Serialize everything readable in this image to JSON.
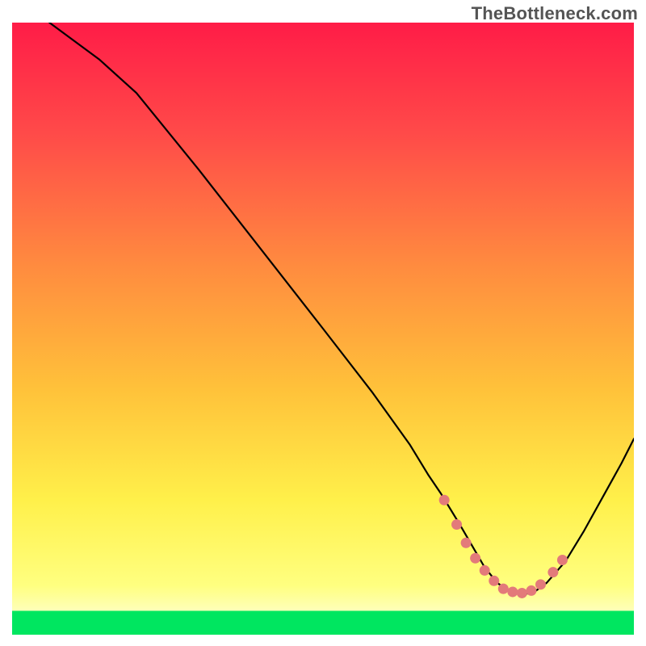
{
  "watermark": "TheBottleneck.com",
  "chart_data": {
    "type": "line",
    "title": "",
    "xlabel": "",
    "ylabel": "",
    "xlim": [
      0,
      100
    ],
    "ylim": [
      0,
      100
    ],
    "grid": false,
    "legend": false,
    "background_gradient_top": "#FF1C47",
    "background_gradient_mid": "#FFA83C",
    "background_gradient_low": "#FFFF80",
    "background_gradient_bottom_band": "#00E660",
    "series": [
      {
        "name": "bottleneck-curve",
        "color": "#000000",
        "x": [
          6,
          10,
          14,
          20,
          30,
          40,
          50,
          58,
          64,
          67,
          69,
          72,
          74,
          76,
          78,
          80,
          82,
          84,
          86,
          89,
          92,
          95,
          98,
          100
        ],
        "y": [
          100,
          97,
          94,
          88.5,
          76,
          63,
          50,
          39.5,
          31,
          26,
          23,
          18,
          14.5,
          11,
          8.5,
          7,
          6.5,
          7,
          8.5,
          12,
          17,
          22.5,
          28,
          32
        ]
      }
    ],
    "highlight_points": {
      "name": "optimal-range-dots",
      "color": "#E37A7A",
      "x": [
        69.5,
        71.5,
        73,
        74.5,
        76,
        77.5,
        79,
        80.5,
        82,
        83.5,
        85,
        87,
        88.5
      ],
      "y": [
        22.0,
        18.0,
        15.0,
        12.5,
        10.5,
        8.8,
        7.5,
        7.0,
        6.8,
        7.2,
        8.2,
        10.2,
        12.2
      ]
    }
  }
}
